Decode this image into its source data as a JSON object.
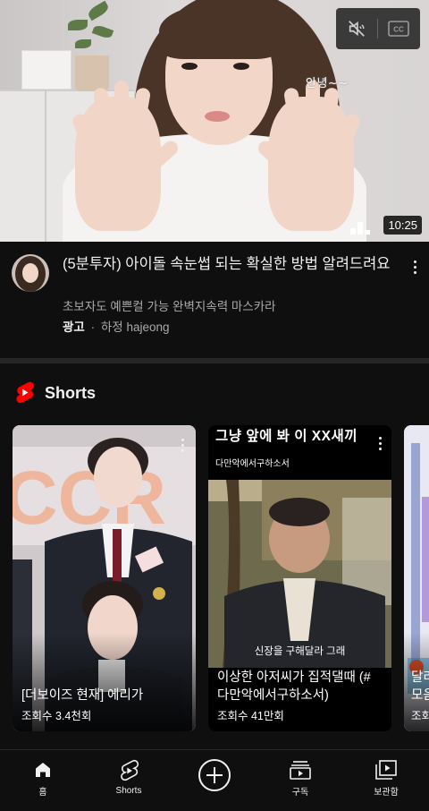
{
  "hero_video": {
    "overlay_caption": "안녕~~",
    "duration": "10:25"
  },
  "ad": {
    "title": "(5분투자) 아이돌 속눈썹 되는 확실한 방법 알려드려요",
    "subtitle": "초보자도 예쁜컬 가능 완벽지속력 마스카라",
    "badge": "광고",
    "separator": "·",
    "channel": "하정 hajeong"
  },
  "shorts": {
    "heading": "Shorts",
    "accent_color": "#ff0000",
    "items": [
      {
        "title": "[더보이즈 현재] 에리가",
        "views": "조회수 3.4천회"
      },
      {
        "top_caption": "그냥 앞에 봐 이 XX새끼",
        "sub_caption": "다만악에서구하소서",
        "subtitle_in_video": "신장을 구해달라 그래",
        "title": "이상한 아저씨가 집적댈때 (#다만악에서구하소서)",
        "views": "조회수 41만회"
      },
      {
        "title": "달리 모음",
        "views": "조회"
      }
    ]
  },
  "bottom_nav": {
    "items": [
      {
        "label": "홈",
        "icon": "home-icon"
      },
      {
        "label": "Shorts",
        "icon": "shorts-icon"
      },
      {
        "label": "",
        "icon": "create-icon"
      },
      {
        "label": "구독",
        "icon": "subscriptions-icon"
      },
      {
        "label": "보관함",
        "icon": "library-icon"
      }
    ]
  }
}
